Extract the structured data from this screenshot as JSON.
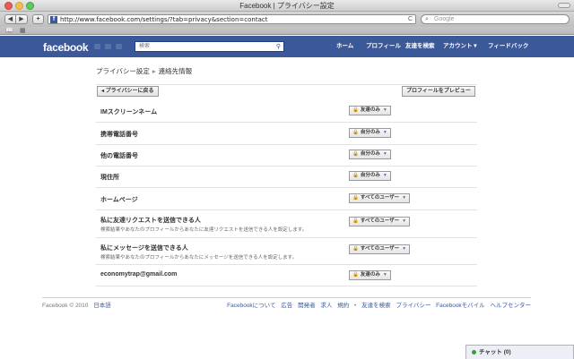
{
  "window": {
    "title": "Facebook | プライバシー設定"
  },
  "browser": {
    "back_glyph": "◀",
    "forward_glyph": "▶",
    "plus_glyph": "+",
    "url": "http://www.facebook.com/settings/?tab=privacy&section=contact",
    "reload_glyph": "C",
    "search_placeholder": "Google",
    "favicon_letter": "f"
  },
  "fb": {
    "logo": "facebook",
    "search_placeholder": "検索",
    "nav": [
      "ホーム",
      "プロフィール",
      "友達を検索",
      "アカウント ▾",
      "フィードバック"
    ]
  },
  "page": {
    "breadcrumb_root": "プライバシー設定",
    "breadcrumb_sep": "▸",
    "breadcrumb_current": "連絡先情報",
    "back_button": "◂ プライバシーに戻る",
    "preview_button": "プロフィールをプレビュー"
  },
  "settings": [
    {
      "label": "IMスクリーンネーム",
      "help": "",
      "value": "友達のみ"
    },
    {
      "label": "携帯電話番号",
      "help": "",
      "value": "自分のみ"
    },
    {
      "label": "他の電話番号",
      "help": "",
      "value": "自分のみ"
    },
    {
      "label": "現住所",
      "help": "",
      "value": "自分のみ"
    },
    {
      "label": "ホームページ",
      "help": "",
      "value": "すべてのユーザー"
    },
    {
      "label": "私に友達リクエストを送信できる人",
      "help": "検索結果やあなたのプロフィールからあなたに友達リクエストを送信できる人を設定します。",
      "value": "すべてのユーザー"
    },
    {
      "label": "私にメッセージを送信できる人",
      "help": "検索結果やあなたのプロフィールからあなたにメッセージを送信できる人を設定します。",
      "value": "すべてのユーザー"
    },
    {
      "label": "economytrap@gmail.com",
      "help": "",
      "value": "友達のみ"
    }
  ],
  "footer": {
    "copyright": "Facebook © 2010",
    "language": "日本語",
    "links": [
      "Facebookについて",
      "広告",
      "開発者",
      "求人",
      "規約",
      "•",
      "友達を検索",
      "プライバシー",
      "Facebookモバイル",
      "ヘルプセンター"
    ]
  },
  "chat": {
    "label": "チャット (0)"
  },
  "colors": {
    "fb_blue": "#3b5998",
    "link": "#3b5998"
  }
}
